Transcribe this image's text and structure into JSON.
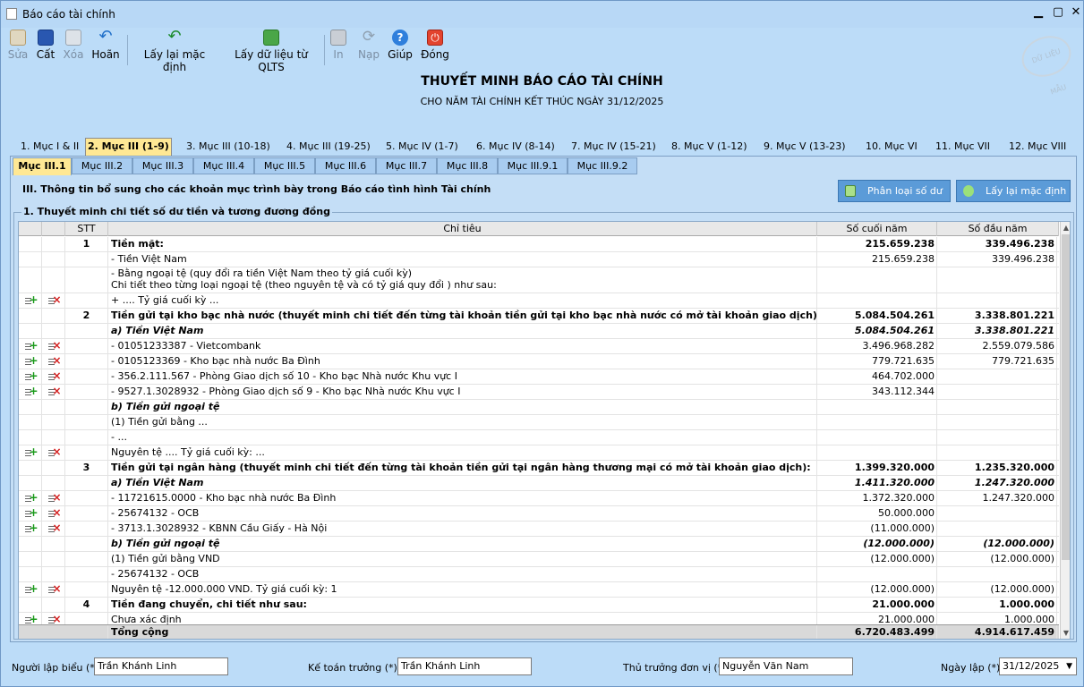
{
  "window": {
    "title": "Báo cáo tài chính"
  },
  "toolbar": {
    "edit": "Sửa",
    "save": "Cất",
    "delete": "Xóa",
    "undo": "Hoãn",
    "reset_default": "Lấy lại mặc định",
    "fetch_data": "Lấy dữ liệu từ QLTS",
    "print": "In",
    "load": "Nạp",
    "help": "Giúp",
    "close": "Đóng"
  },
  "stamp_text": "DỮ LIỆU MẪU",
  "header": {
    "title": "THUYẾT MINH BÁO CÁO TÀI CHÍNH",
    "subtitle": "CHO NĂM TÀI CHÍNH KẾT THÚC NGÀY 31/12/2025"
  },
  "main_tabs": [
    "1. Mục I & II",
    "2. Mục III (1-9)",
    "3. Mục III (10-18)",
    "4. Mục III (19-25)",
    "5. Mục IV (1-7)",
    "6. Mục IV (8-14)",
    "7. Mục IV (15-21)",
    "8. Mục V (1-12)",
    "9. Mục V (13-23)",
    "10. Mục VI",
    "11. Mục VII",
    "12. Mục VIII"
  ],
  "sub_tabs": [
    "Mục III.1",
    "Mục III.2",
    "Mục III.3",
    "Mục III.4",
    "Mục III.5",
    "Mục III.6",
    "Mục III.7",
    "Mục III.8",
    "Mục III.9.1",
    "Mục III.9.2"
  ],
  "section": {
    "title": "III. Thông tin bổ sung cho các khoản mục trình bày trong Báo cáo tình hình Tài chính",
    "classify_button": "Phân loại số dư",
    "reset_button": "Lấy lại mặc định",
    "group_title": "1. Thuyết minh chi tiết số dư tiền và tương đương đồng"
  },
  "grid": {
    "headers": {
      "stt": "STT",
      "name": "Chỉ tiêu",
      "end": "Số cuối năm",
      "start": "Số đầu năm"
    },
    "rows": [
      {
        "stt": "1",
        "name": "Tiền mặt:",
        "v1": "215.659.238",
        "v2": "339.496.238",
        "style": "bold"
      },
      {
        "stt": "",
        "name": "- Tiền Việt Nam",
        "v1": "215.659.238",
        "v2": "339.496.238"
      },
      {
        "stt": "",
        "name": "- Bằng ngoại tệ (quy đổi ra tiền Việt Nam theo tỷ giá cuối kỳ)",
        "name2": "Chi tiết theo từng loại ngoại tệ (theo nguyên tệ và có tỷ giá quy đổi ) như sau:",
        "v1": "",
        "v2": "",
        "double": true
      },
      {
        "stt": "",
        "name": "+ .... Tỷ giá cuối kỳ ...",
        "v1": "",
        "v2": "",
        "actions": true
      },
      {
        "stt": "2",
        "name": "Tiền gửi tại kho bạc nhà nước (thuyết minh chi tiết đến từng tài khoản tiền gửi tại kho bạc nhà nước có mở tài khoản giao dịch):",
        "v1": "5.084.504.261",
        "v2": "3.338.801.221",
        "style": "bold"
      },
      {
        "stt": "",
        "name": "a) Tiền Việt Nam",
        "v1": "5.084.504.261",
        "v2": "3.338.801.221",
        "style": "bi"
      },
      {
        "stt": "",
        "name": "- 01051233387 - Vietcombank",
        "v1": "3.496.968.282",
        "v2": "2.559.079.586",
        "actions": true
      },
      {
        "stt": "",
        "name": "- 0105123369 - Kho bạc nhà nước Ba Đình",
        "v1": "779.721.635",
        "v2": "779.721.635",
        "actions": true
      },
      {
        "stt": "",
        "name": "- 356.2.111.567 - Phòng Giao dịch số 10 - Kho bạc Nhà nước Khu vực I",
        "v1": "464.702.000",
        "v2": "",
        "actions": true
      },
      {
        "stt": "",
        "name": "- 9527.1.3028932 - Phòng Giao dịch số 9 - Kho bạc Nhà nước Khu vực I",
        "v1": "343.112.344",
        "v2": "",
        "actions": true
      },
      {
        "stt": "",
        "name": "b) Tiền gửi ngoại tệ",
        "v1": "",
        "v2": "",
        "style": "bi"
      },
      {
        "stt": "",
        "name": "(1) Tiền gửi bằng ...",
        "v1": "",
        "v2": ""
      },
      {
        "stt": "",
        "name": "- ...",
        "v1": "",
        "v2": ""
      },
      {
        "stt": "",
        "name": "Nguyên tệ .... Tỷ giá cuối kỳ: ...",
        "v1": "",
        "v2": "",
        "actions": true
      },
      {
        "stt": "3",
        "name": "Tiền gửi tại ngân hàng (thuyết minh chi tiết đến từng tài khoản tiền gửi tại ngân hàng thương mại có mở tài khoản giao dịch):",
        "v1": "1.399.320.000",
        "v2": "1.235.320.000",
        "style": "bold"
      },
      {
        "stt": "",
        "name": "a) Tiền Việt Nam",
        "v1": "1.411.320.000",
        "v2": "1.247.320.000",
        "style": "bi"
      },
      {
        "stt": "",
        "name": "- 11721615.0000 - Kho bạc nhà nước Ba Đình",
        "v1": "1.372.320.000",
        "v2": "1.247.320.000",
        "actions": true
      },
      {
        "stt": "",
        "name": "- 25674132 - OCB",
        "v1": "50.000.000",
        "v2": "",
        "actions": true
      },
      {
        "stt": "",
        "name": "- 3713.1.3028932 - KBNN Cầu Giấy - Hà Nội",
        "v1": "(11.000.000)",
        "v2": "",
        "actions": true
      },
      {
        "stt": "",
        "name": "b) Tiền gửi ngoại tệ",
        "v1": "(12.000.000)",
        "v2": "(12.000.000)",
        "style": "bi"
      },
      {
        "stt": "",
        "name": "(1) Tiền gửi bằng VND",
        "v1": "(12.000.000)",
        "v2": "(12.000.000)"
      },
      {
        "stt": "",
        "name": "- 25674132 - OCB",
        "v1": "",
        "v2": ""
      },
      {
        "stt": "",
        "name": "Nguyên tệ -12.000.000 VND. Tỷ giá cuối kỳ: 1",
        "v1": "(12.000.000)",
        "v2": "(12.000.000)",
        "actions": true
      },
      {
        "stt": "4",
        "name": "Tiền đang chuyển, chi tiết như sau:",
        "v1": "21.000.000",
        "v2": "1.000.000",
        "style": "bold"
      },
      {
        "stt": "",
        "name": "Chưa xác định",
        "v1": "21.000.000",
        "v2": "1.000.000",
        "actions": true
      }
    ],
    "total": {
      "label": "Tổng cộng",
      "v1": "6.720.483.499",
      "v2": "4.914.617.459"
    }
  },
  "footer": {
    "preparer_label": "Người lập biểu (*)",
    "preparer": "Trần Khánh Linh",
    "accountant_label": "Kế toán trưởng (*)",
    "accountant": "Trần Khánh Linh",
    "head_label": "Thủ trưởng đơn vị (*)",
    "head": "Nguyễn Văn Nam",
    "date_label": "Ngày lập (*)",
    "date": "31/12/2025"
  },
  "colors": {
    "accent": "#5b9bd8",
    "active_tab": "#ffe894",
    "background": "#bcdcf8"
  }
}
